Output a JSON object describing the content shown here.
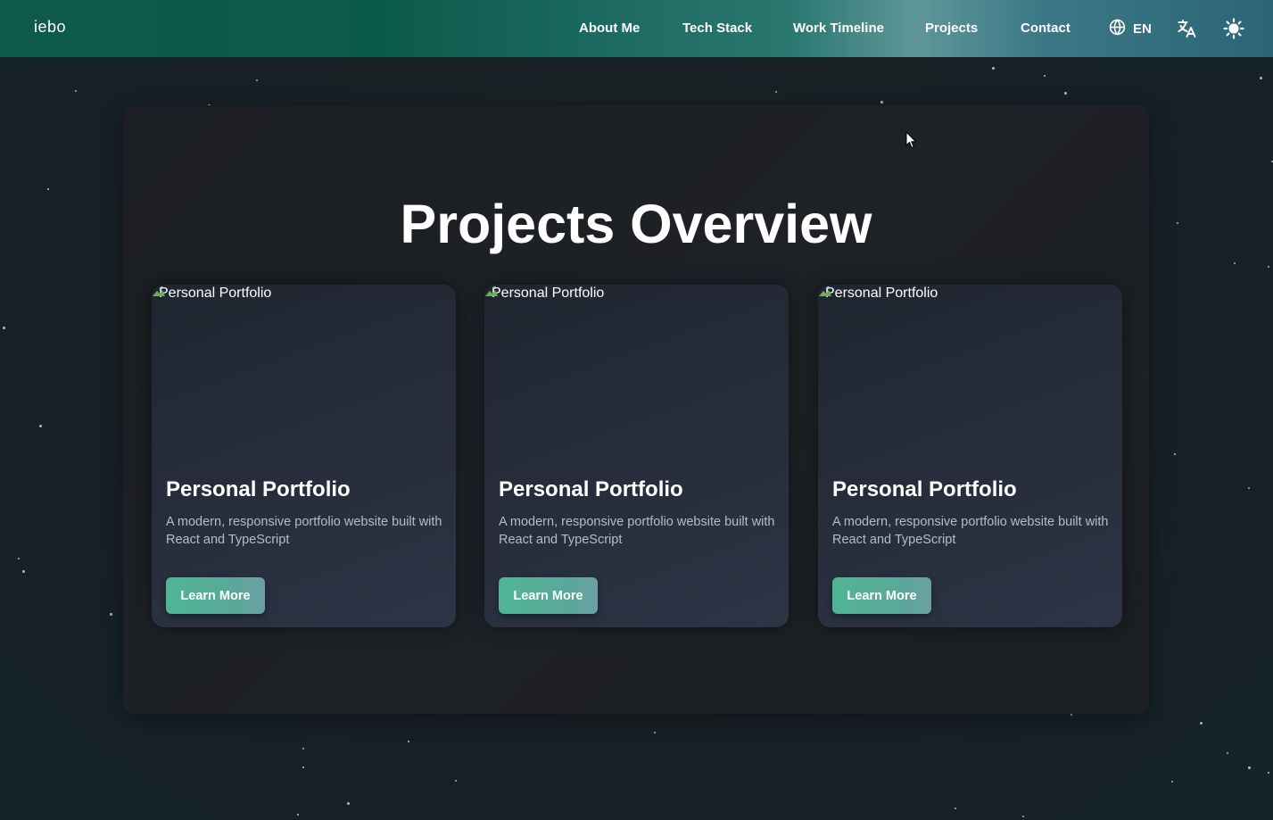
{
  "brand": {
    "logo": "iebo",
    "accent": "#4fb596",
    "nav_gradient_start": "#0b5b4c"
  },
  "nav": {
    "items": [
      "About Me",
      "Tech Stack",
      "Work Timeline",
      "Projects",
      "Contact"
    ],
    "language_label": "EN",
    "language_icon": "globe-icon",
    "translate_icon": "translate-icon",
    "theme_icon": "sun-icon"
  },
  "page": {
    "title": "Projects Overview"
  },
  "projects": [
    {
      "image_alt": "Personal Portfolio",
      "title": "Personal Portfolio",
      "description": "A modern, responsive portfolio website built with React and TypeScript",
      "button_label": "Learn More"
    },
    {
      "image_alt": "Personal Portfolio",
      "title": "Personal Portfolio",
      "description": "A modern, responsive portfolio website built with React and TypeScript",
      "button_label": "Learn More"
    },
    {
      "image_alt": "Personal Portfolio",
      "title": "Personal Portfolio",
      "description": "A modern, responsive portfolio website built with React and TypeScript",
      "button_label": "Learn More"
    }
  ]
}
